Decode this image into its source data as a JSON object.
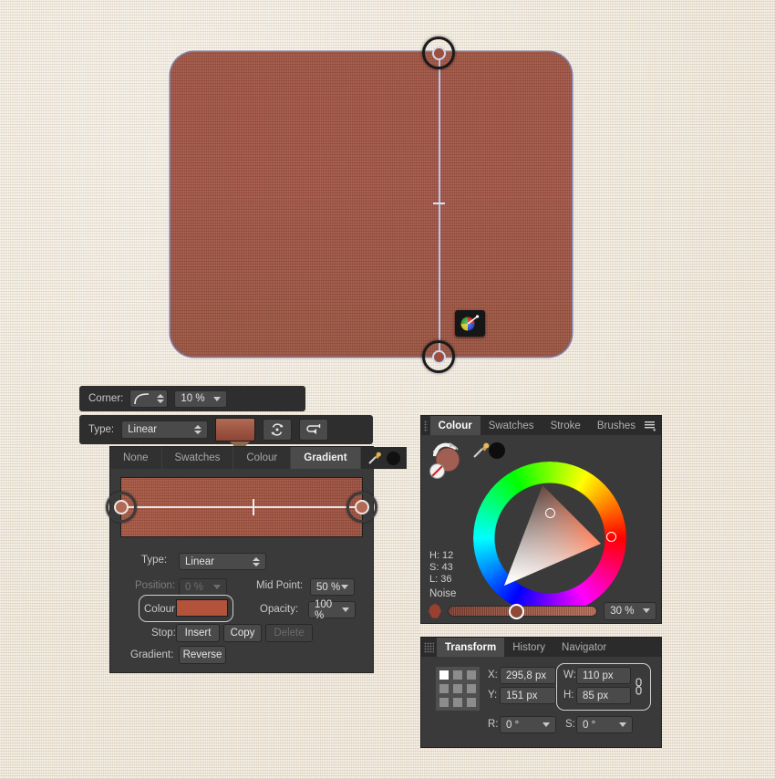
{
  "app": {
    "background_color": "#e9ddc9",
    "shape_color": "#9c4f3d"
  },
  "canvas": {
    "shape_name": "rounded-rectangle",
    "gradient_handle_start": "start",
    "gradient_handle_end": "end",
    "picker_cursor_icon": "color-picker-icon"
  },
  "corner_toolbar": {
    "label": "Corner:",
    "corner_type_icon": "rounded-corner-icon",
    "radius_value": "10 %"
  },
  "type_toolbar": {
    "label": "Type:",
    "type_value": "Linear",
    "swatch_name": "gradient-swatch",
    "cycle_icon": "cycle-colors-icon",
    "reverse_icon": "reverse-gradient-icon"
  },
  "gradient_panel": {
    "tabs": [
      {
        "label": "None",
        "active": false
      },
      {
        "label": "Swatches",
        "active": false
      },
      {
        "label": "Colour",
        "active": false
      },
      {
        "label": "Gradient",
        "active": true
      }
    ],
    "tools": {
      "eyedropper_icon": "eyedropper-icon",
      "current_color_icon": "current-color-dot"
    },
    "fields": {
      "type_label": "Type:",
      "type_value": "Linear",
      "position_label": "Position:",
      "position_value": "0 %",
      "midpoint_label": "Mid Point:",
      "midpoint_value": "50 %",
      "colour_label": "Colour:",
      "colour_value_hex": "#b3533b",
      "opacity_label": "Opacity:",
      "opacity_value": "100 %",
      "stop_label": "Stop:",
      "stop_insert": "Insert",
      "stop_copy": "Copy",
      "stop_delete": "Delete",
      "gradient_label": "Gradient:",
      "gradient_reverse": "Reverse"
    }
  },
  "colour_panel": {
    "tabs": [
      {
        "label": "Colour",
        "active": true
      },
      {
        "label": "Swatches",
        "active": false
      },
      {
        "label": "Stroke",
        "active": false
      },
      {
        "label": "Brushes",
        "active": false
      }
    ],
    "menu_icon": "hamburger-menu-icon",
    "fill_stroke_icon": "fill-stroke-swatch",
    "swap_icon": "swap-fill-stroke-icon",
    "none_icon": "no-colour-icon",
    "eyedropper_icon": "eyedropper-icon",
    "black_dot_icon": "black-colour-dot",
    "wheel_name": "hsl-colour-wheel",
    "readout": {
      "h": "H: 12",
      "s": "S: 43",
      "l": "L: 36"
    },
    "noise_label": "Noise",
    "noise_value": "30 %"
  },
  "transform_panel": {
    "tabs": [
      {
        "label": "Transform",
        "active": true
      },
      {
        "label": "History",
        "active": false
      },
      {
        "label": "Navigator",
        "active": false
      }
    ],
    "anchor_grid_name": "anchor-point-grid",
    "fields": {
      "x_label": "X:",
      "x_value": "295,8 px",
      "y_label": "Y:",
      "y_value": "151 px",
      "w_label": "W:",
      "w_value": "110 px",
      "h_label": "H:",
      "h_value": "85 px",
      "r_label": "R:",
      "r_value": "0 °",
      "s_label": "S:",
      "s_value": "0 °"
    },
    "link_icon": "link-aspect-ratio-icon"
  }
}
